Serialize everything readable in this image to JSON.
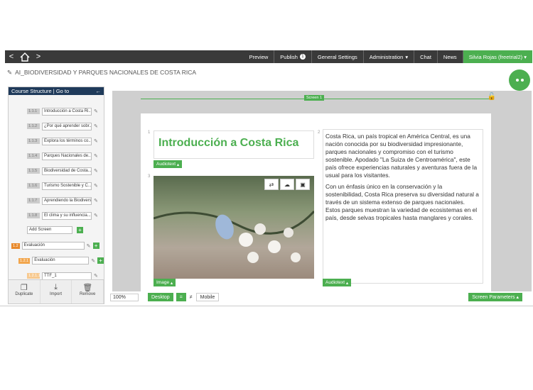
{
  "nav": {
    "back": "<",
    "forward": ">",
    "home_icon": "home-icon"
  },
  "menu": [
    {
      "label": "Preview"
    },
    {
      "label": "Publish",
      "badge": "1"
    },
    {
      "label": "General Settings"
    },
    {
      "label": "Administration"
    },
    {
      "label": "Chat"
    },
    {
      "label": "News"
    }
  ],
  "user": "Silvia Rojas (freetrial2)",
  "breadcrumb": "AI_BIODIVERSIDAD Y PARQUES NACIONALES DE COSTA RICA",
  "sidebar": {
    "title": "Course Structure",
    "goto": "Go to",
    "items": [
      {
        "num": "1.1.1",
        "label": "Introducción a Costa Ri..."
      },
      {
        "num": "1.1.2",
        "label": "¿Por qué aprender sobr..."
      },
      {
        "num": "1.1.3",
        "label": "Explora los términos co..."
      },
      {
        "num": "1.1.4",
        "label": "Parques Nacionales de..."
      },
      {
        "num": "1.1.5",
        "label": "Biodiversidad de Costa..."
      },
      {
        "num": "1.1.6",
        "label": "Turismo Sostenible y C..."
      },
      {
        "num": "1.1.7",
        "label": "Aprendiendo la Biodivers..."
      },
      {
        "num": "1.1.8",
        "label": "El clima y su influencia..."
      }
    ],
    "add_screen": "Add Screen",
    "section": {
      "num": "1.2",
      "label": "Evaluación"
    },
    "subsection": {
      "num": "1.2.1",
      "label": "Evaluación"
    },
    "subitem": {
      "num": "1.2.1.1",
      "label": "TTF_1"
    },
    "footer": {
      "duplicate": "Duplicate",
      "import": "Import",
      "remove": "Remove"
    }
  },
  "screen": {
    "tag": "Screen 1",
    "title": "Introducción a Costa Rica",
    "audiotext": "Audiotext",
    "image_label": "Image",
    "box1_num": "1",
    "box2_num": "2",
    "box3_num": "3",
    "para1": "Costa Rica, un país tropical en América Central, es una nación conocida por su biodiversidad impresionante, parques nacionales y compromiso con el turismo sostenible. Apodado \"La Suiza de Centroamérica\", este país ofrece experiencias naturales y aventuras fuera de la usual para los visitantes.",
    "para2": "Con un énfasis único en la conservación y la sostenibilidad, Costa Rica preserva su diversidad natural a través de un sistema extenso de parques nacionales. Estos parques muestran la variedad de ecosistemas en el país, desde selvas tropicales hasta manglares y corales."
  },
  "bottom": {
    "zoom": "100%",
    "desktop": "Desktop",
    "equal": "=",
    "notequal": "≠",
    "mobile": "Mobile",
    "params": "Screen Parameters"
  }
}
